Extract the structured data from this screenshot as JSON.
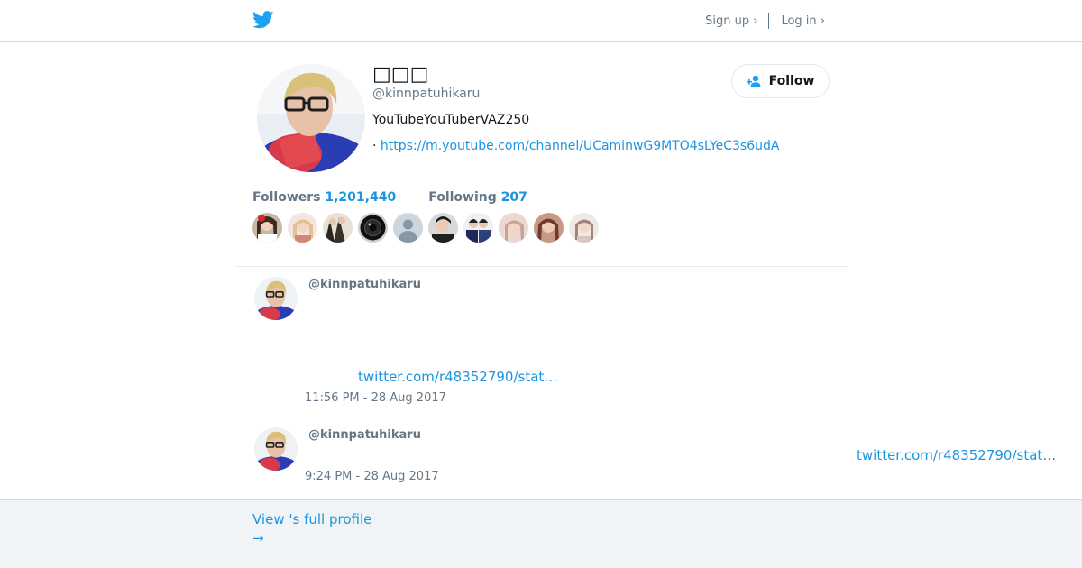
{
  "header": {
    "logo_icon": "twitter-bird-icon",
    "signup_label": "Sign up ›",
    "login_label": "Log in ›"
  },
  "profile": {
    "name": "□□□",
    "handle": "@kinnpatuhikaru",
    "bio": "YouTubeYouTuberVAZ250",
    "url_prefix": "·",
    "url": "https://m.youtube.com/channel/UCaminwG9MTO4sLYeC3s6udA",
    "follow_label": "Follow",
    "follow_icon": "add-user-icon"
  },
  "stats": {
    "followers_label": "Followers",
    "followers_count": "1,201,440",
    "following_label": "Following",
    "following_count": "207"
  },
  "tweets": [
    {
      "handle": "@kinnpatuhikaru",
      "link": "twitter.com/r48352790/stat…",
      "time": "11:56 PM - 28 Aug 2017"
    },
    {
      "handle": "@kinnpatuhikaru",
      "link": "twitter.com/r48352790/stat…",
      "time": "9:24 PM - 28 Aug 2017"
    }
  ],
  "footer": {
    "full_profile_label": "View 's full profile",
    "arrow": "→"
  },
  "colors": {
    "brand": "#1da1f2",
    "link": "#1b95e0",
    "muted": "#657786"
  }
}
